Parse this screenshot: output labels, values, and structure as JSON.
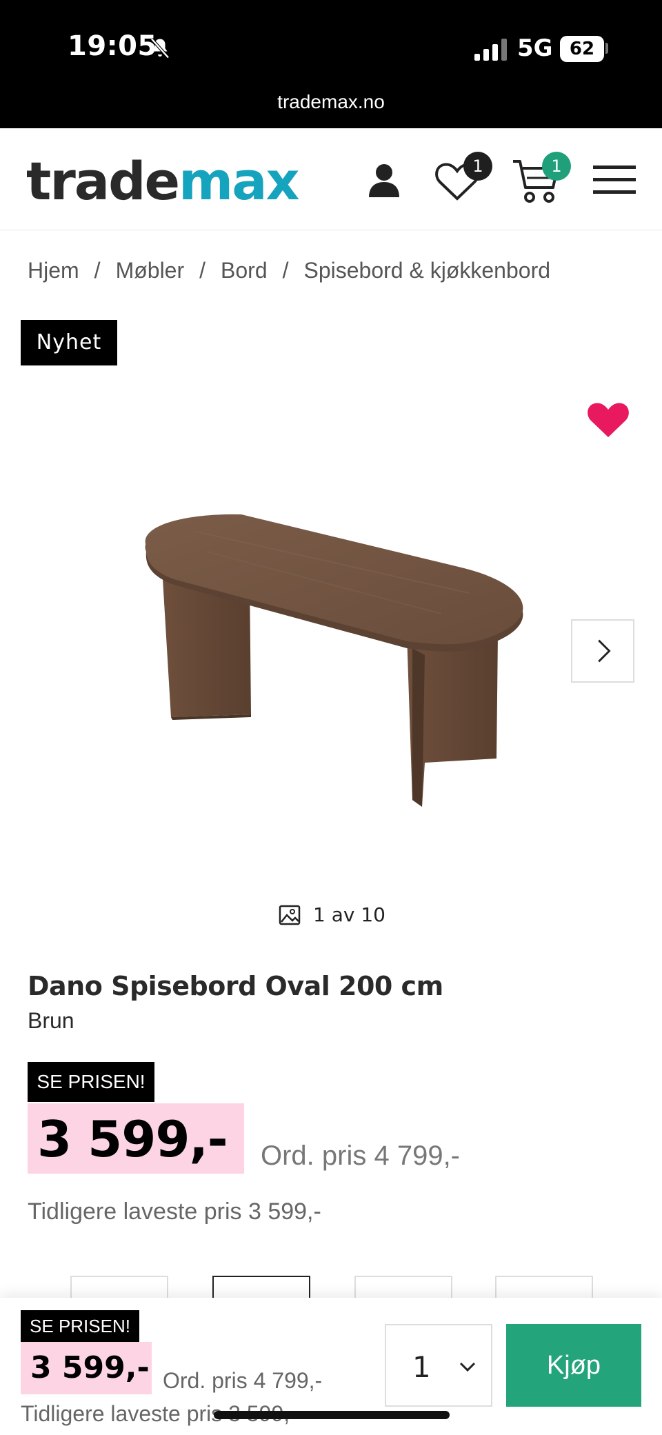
{
  "status_bar": {
    "time": "19:05",
    "network": "5G",
    "battery": "62",
    "url": "trademax.no",
    "icons": [
      "bell-muted-icon",
      "signal-icon"
    ]
  },
  "header": {
    "logo_part1": "trade",
    "logo_part2": "max",
    "logo_color_dark": "#2a2a2a",
    "logo_color_accent": "#16a3be",
    "favorites_count": "1",
    "cart_count": "1",
    "cart_badge_color": "#1fa07a",
    "icons": [
      "user-icon",
      "heart-icon",
      "cart-icon",
      "menu-icon"
    ]
  },
  "breadcrumb": {
    "items": [
      "Hjem",
      "Møbler",
      "Bord",
      "Spisebord & kjøkkenbord"
    ],
    "separator": "/"
  },
  "gallery": {
    "badge": "Nyhet",
    "counter": "1 av 10",
    "favorite_color": "#e8195f"
  },
  "product": {
    "title": "Dano Spisebord Oval 200 cm",
    "color": "Brun",
    "promo_label": "SE PRISEN!",
    "price": "3 599,-",
    "ord_price": "Ord. pris 4 799,-",
    "lowest_price": "Tidligere laveste pris 3 599,-",
    "price_highlight_color": "#fcd4e4"
  },
  "bottom_bar": {
    "promo_label": "SE PRISEN!",
    "price": "3 599,-",
    "ord_price": "Ord. pris 4 799,-",
    "lowest_price": "Tidligere laveste pris 3 599,-",
    "quantity": "1",
    "buy_label": "Kjøp",
    "buy_color": "#23a47b"
  }
}
